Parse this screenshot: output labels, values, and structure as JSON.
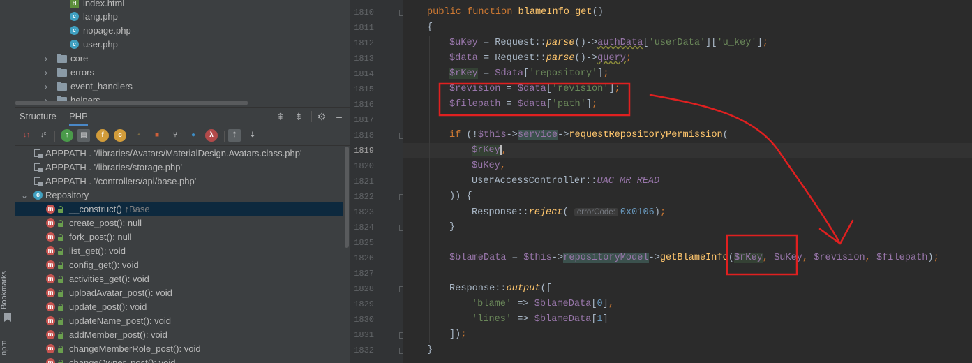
{
  "side_strip": {
    "bookmarks_label": "Bookmarks",
    "npm_label": "npm"
  },
  "project_tree": {
    "items": [
      {
        "label": "index.html"
      },
      {
        "label": "lang.php"
      },
      {
        "label": "nopage.php"
      },
      {
        "label": "user.php"
      },
      {
        "label": "core"
      },
      {
        "label": "errors"
      },
      {
        "label": "event_handlers"
      },
      {
        "label": "helpers"
      }
    ]
  },
  "panel": {
    "tabs": [
      {
        "label": "Structure"
      },
      {
        "label": "PHP"
      }
    ],
    "active_tab": "PHP",
    "toolbar_badges": {
      "f": "f",
      "c": "c",
      "lambda": "λ"
    }
  },
  "structure": {
    "includes": [
      "APPPATH . '/libraries/Avatars/MaterialDesign.Avatars.class.php'",
      "APPPATH . '/libraries/storage.php'",
      "APPPATH . '/controllers/api/base.php'"
    ],
    "class_name": "Repository",
    "class_badge": "c",
    "method_badge": "m",
    "methods": [
      {
        "label": "__construct()",
        "inherit": "↑Base"
      },
      {
        "label": "create_post(): null"
      },
      {
        "label": "fork_post(): null"
      },
      {
        "label": "list_get(): void"
      },
      {
        "label": "config_get(): void"
      },
      {
        "label": "activities_get(): void"
      },
      {
        "label": "uploadAvatar_post(): void"
      },
      {
        "label": "update_post(): void"
      },
      {
        "label": "updateName_post(): void"
      },
      {
        "label": "addMember_post(): void"
      },
      {
        "label": "changeMemberRole_post(): void"
      },
      {
        "label": "changeOwner_post(): void"
      }
    ]
  },
  "editor": {
    "line_numbers": [
      "1810",
      "1811",
      "1812",
      "1813",
      "1814",
      "1815",
      "1816",
      "1817",
      "1818",
      "1819",
      "1820",
      "1821",
      "1822",
      "1823",
      "1824",
      "1825",
      "1826",
      "1827",
      "1828",
      "1829",
      "1830",
      "1831",
      "1832"
    ],
    "current_line": "1819",
    "param_hint": "errorCode:",
    "highlight_color": "#e02020"
  }
}
